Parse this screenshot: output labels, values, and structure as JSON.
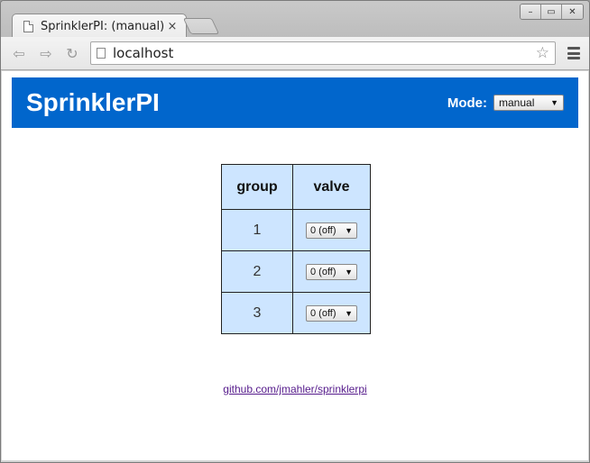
{
  "browser": {
    "tab_title": "SprinklerPI: (manual)",
    "tab_close": "×",
    "url": "localhost",
    "window_buttons": [
      "–",
      "▭",
      "✕"
    ]
  },
  "header": {
    "title": "SprinklerPI",
    "mode_label": "Mode:",
    "mode_value": "manual"
  },
  "table": {
    "headers": [
      "group",
      "valve"
    ],
    "rows": [
      {
        "group": "1",
        "valve": "0 (off)"
      },
      {
        "group": "2",
        "valve": "0 (off)"
      },
      {
        "group": "3",
        "valve": "0 (off)"
      }
    ]
  },
  "footer": {
    "link_text": "github.com/jmahler/sprinklerpi"
  },
  "colors": {
    "header_bg": "#0166cc",
    "table_cell_bg": "#cde5ff",
    "link": "#551a8b"
  },
  "icons": [
    "page-icon",
    "close-icon",
    "back-icon",
    "forward-icon",
    "reload-icon",
    "star-icon",
    "menu-icon",
    "dropdown-caret-icon"
  ]
}
